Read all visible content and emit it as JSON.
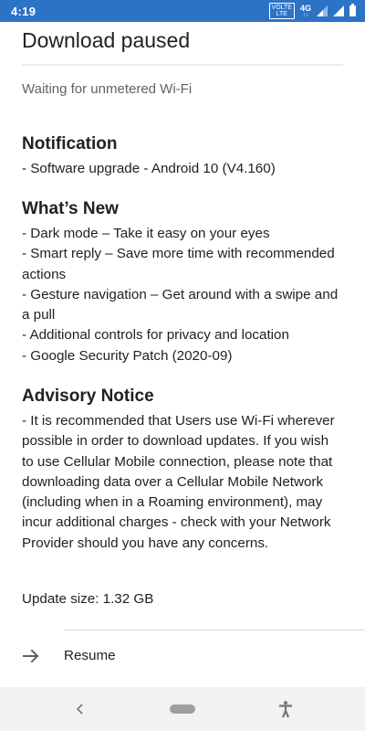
{
  "status_bar": {
    "time": "4:19",
    "volte_top": "VOLTE",
    "volte_bottom": "LTE",
    "network": "4G"
  },
  "page": {
    "title": "Download paused",
    "subtitle": "Waiting for unmetered Wi-Fi"
  },
  "notification": {
    "heading": "Notification",
    "lines": [
      "- Software upgrade - Android 10 (V4.160)"
    ]
  },
  "whats_new": {
    "heading": "What’s New",
    "lines": [
      "- Dark mode – Take it easy on your eyes",
      "- Smart reply – Save more time with recommended",
      "actions",
      "- Gesture navigation – Get around with a swipe and",
      "a pull",
      "- Additional controls for privacy and location",
      "- Google Security Patch (2020-09)"
    ]
  },
  "advisory": {
    "heading": "Advisory Notice",
    "lines": [
      "- It is recommended that Users use Wi-Fi wherever",
      "possible in order to download updates. If you wish",
      "to use Cellular Mobile connection, please note that",
      "downloading data over a Cellular Mobile Network",
      "(including when in a Roaming environment), may",
      "incur additional charges - check with your Network",
      "Provider should you have any concerns."
    ]
  },
  "update_size": "Update size: 1.32 GB",
  "resume": {
    "label": "Resume",
    "icon": "arrow-right-icon"
  },
  "colors": {
    "status_bar": "#2c73c6",
    "text_primary": "#202124",
    "text_secondary": "#5f6368",
    "nav_bar": "#f2f2f2"
  }
}
